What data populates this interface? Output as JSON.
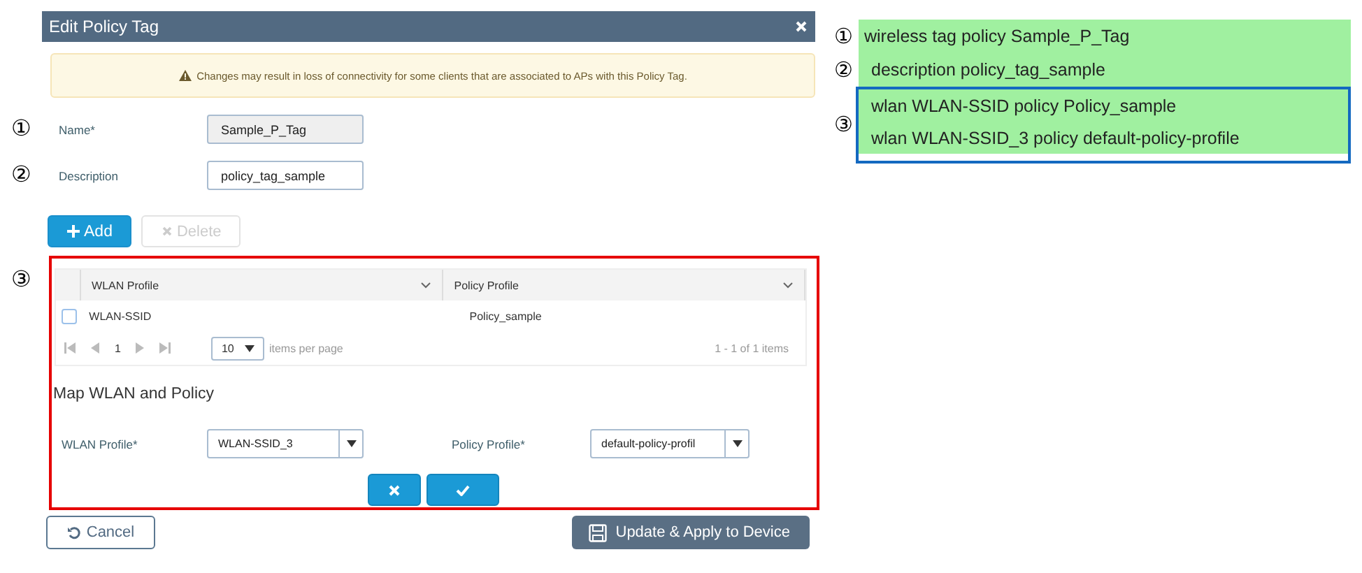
{
  "dialog": {
    "title": "Edit Policy Tag",
    "warning": "Changes may result in loss of connectivity for some clients that are associated to APs with this Policy Tag.",
    "fields": [
      {
        "marker": "①",
        "label": "Name*",
        "value": "Sample_P_Tag",
        "disabled": true
      },
      {
        "marker": "②",
        "label": "Description",
        "value": "policy_tag_sample",
        "disabled": false
      }
    ],
    "add_button": {
      "label": "Add",
      "disabled": false
    },
    "delete_button": {
      "label": "Delete",
      "disabled": true
    },
    "section_marker": "③",
    "table": {
      "columns": [
        "WLAN Profile",
        "Policy Profile"
      ],
      "rows": [
        {
          "checked": false,
          "cells": [
            "WLAN-SSID",
            "Policy_sample"
          ]
        }
      ],
      "pager": {
        "page": "1",
        "page_size": "10",
        "page_size_label": "items per page",
        "summary": "1 - 1 of 1 items"
      }
    },
    "map": {
      "title": "Map WLAN and Policy",
      "wlan_label": "WLAN Profile*",
      "wlan_value": "WLAN-SSID_3",
      "policy_label": "Policy Profile*",
      "policy_value": "default-policy-profil"
    },
    "cancel": "Cancel",
    "apply": "Update & Apply to Device"
  },
  "config": {
    "lines": [
      {
        "marker": "①",
        "text": "wireless tag policy Sample_P_Tag",
        "indented": false
      },
      {
        "marker": "②",
        "text": "description policy_tag_sample",
        "indented": true
      }
    ],
    "group": {
      "marker": "③",
      "lines": [
        {
          "text": "wlan WLAN-SSID policy Policy_sample",
          "indented": true
        },
        {
          "text": "wlan WLAN-SSID_3 policy default-policy-profile",
          "indented": true
        }
      ]
    }
  }
}
